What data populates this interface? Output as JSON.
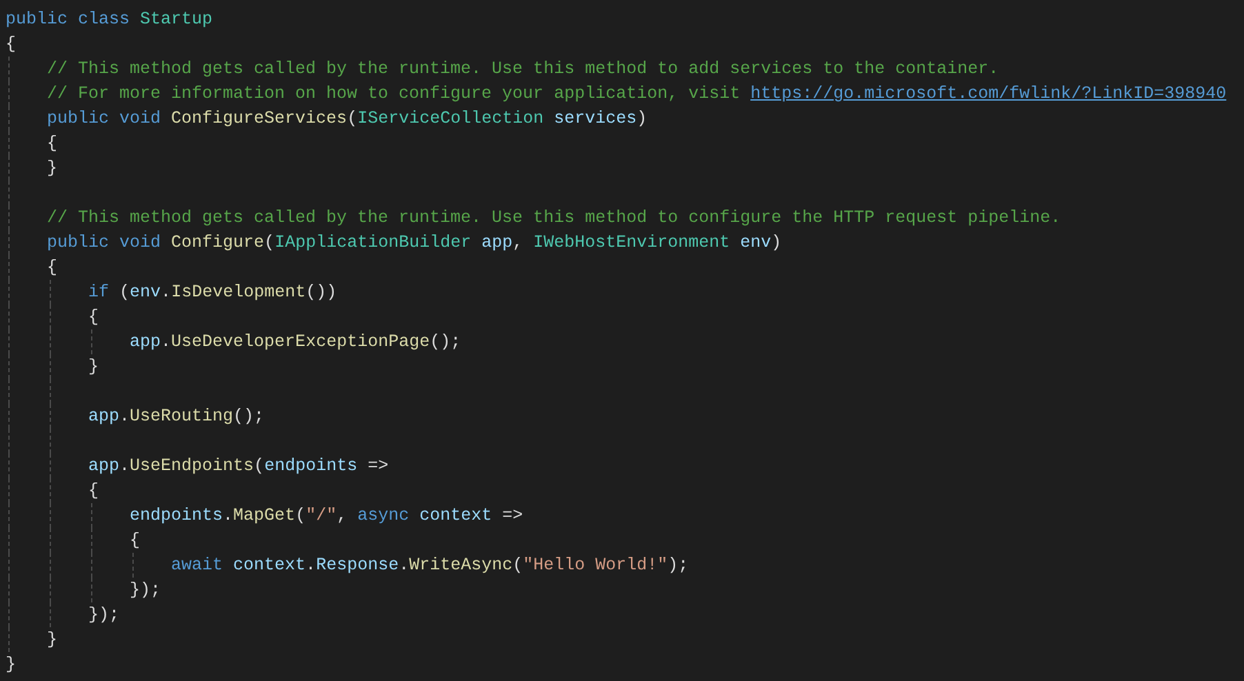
{
  "editor": {
    "lines": [
      {
        "tokens": [
          {
            "text": "public ",
            "kind": "keyword"
          },
          {
            "text": "class ",
            "kind": "keyword"
          },
          {
            "text": "Startup",
            "kind": "type"
          }
        ]
      },
      {
        "tokens": [
          {
            "text": "{",
            "kind": "plain"
          }
        ]
      },
      {
        "tokens": [
          {
            "text": "    // This method gets called by the runtime. Use this method to add services to the container.",
            "kind": "comment"
          }
        ]
      },
      {
        "tokens": [
          {
            "text": "    // For more information on how to configure your application, visit ",
            "kind": "comment"
          },
          {
            "text": "https://go.microsoft.com/fwlink/?LinkID=398940",
            "kind": "link"
          }
        ]
      },
      {
        "tokens": [
          {
            "text": "    public ",
            "kind": "keyword"
          },
          {
            "text": "void ",
            "kind": "keyword"
          },
          {
            "text": "ConfigureServices",
            "kind": "method"
          },
          {
            "text": "(",
            "kind": "plain"
          },
          {
            "text": "IServiceCollection ",
            "kind": "type"
          },
          {
            "text": "services",
            "kind": "variable"
          },
          {
            "text": ")",
            "kind": "plain"
          }
        ]
      },
      {
        "tokens": [
          {
            "text": "    {",
            "kind": "plain"
          }
        ]
      },
      {
        "tokens": [
          {
            "text": "    }",
            "kind": "plain"
          }
        ]
      },
      {
        "kind": "blank"
      },
      {
        "tokens": [
          {
            "text": "    // This method gets called by the runtime. Use this method to configure the HTTP request pipeline.",
            "kind": "comment"
          }
        ]
      },
      {
        "tokens": [
          {
            "text": "    public ",
            "kind": "keyword"
          },
          {
            "text": "void ",
            "kind": "keyword"
          },
          {
            "text": "Configure",
            "kind": "method"
          },
          {
            "text": "(",
            "kind": "plain"
          },
          {
            "text": "IApplicationBuilder ",
            "kind": "type"
          },
          {
            "text": "app",
            "kind": "variable"
          },
          {
            "text": ", ",
            "kind": "plain"
          },
          {
            "text": "IWebHostEnvironment ",
            "kind": "type"
          },
          {
            "text": "env",
            "kind": "variable"
          },
          {
            "text": ")",
            "kind": "plain"
          }
        ]
      },
      {
        "tokens": [
          {
            "text": "    {",
            "kind": "plain"
          }
        ]
      },
      {
        "tokens": [
          {
            "text": "        if",
            "kind": "keyword"
          },
          {
            "text": " (",
            "kind": "plain"
          },
          {
            "text": "env",
            "kind": "variable"
          },
          {
            "text": ".",
            "kind": "plain"
          },
          {
            "text": "IsDevelopment",
            "kind": "method"
          },
          {
            "text": "())",
            "kind": "plain"
          }
        ]
      },
      {
        "tokens": [
          {
            "text": "        {",
            "kind": "plain"
          }
        ]
      },
      {
        "tokens": [
          {
            "text": "            app",
            "kind": "variable"
          },
          {
            "text": ".",
            "kind": "plain"
          },
          {
            "text": "UseDeveloperExceptionPage",
            "kind": "method"
          },
          {
            "text": "();",
            "kind": "plain"
          }
        ]
      },
      {
        "tokens": [
          {
            "text": "        }",
            "kind": "plain"
          }
        ]
      },
      {
        "kind": "blank"
      },
      {
        "tokens": [
          {
            "text": "        app",
            "kind": "variable"
          },
          {
            "text": ".",
            "kind": "plain"
          },
          {
            "text": "UseRouting",
            "kind": "method"
          },
          {
            "text": "();",
            "kind": "plain"
          }
        ]
      },
      {
        "kind": "blank"
      },
      {
        "tokens": [
          {
            "text": "        app",
            "kind": "variable"
          },
          {
            "text": ".",
            "kind": "plain"
          },
          {
            "text": "UseEndpoints",
            "kind": "method"
          },
          {
            "text": "(",
            "kind": "plain"
          },
          {
            "text": "endpoints",
            "kind": "variable"
          },
          {
            "text": " =>",
            "kind": "plain"
          }
        ]
      },
      {
        "tokens": [
          {
            "text": "        {",
            "kind": "plain"
          }
        ]
      },
      {
        "tokens": [
          {
            "text": "            endpoints",
            "kind": "variable"
          },
          {
            "text": ".",
            "kind": "plain"
          },
          {
            "text": "MapGet",
            "kind": "method"
          },
          {
            "text": "(",
            "kind": "plain"
          },
          {
            "text": "\"/\"",
            "kind": "string"
          },
          {
            "text": ", ",
            "kind": "plain"
          },
          {
            "text": "async ",
            "kind": "keyword"
          },
          {
            "text": "context",
            "kind": "variable"
          },
          {
            "text": " =>",
            "kind": "plain"
          }
        ]
      },
      {
        "tokens": [
          {
            "text": "            {",
            "kind": "plain"
          }
        ]
      },
      {
        "tokens": [
          {
            "text": "                await ",
            "kind": "keyword"
          },
          {
            "text": "context",
            "kind": "variable"
          },
          {
            "text": ".",
            "kind": "plain"
          },
          {
            "text": "Response",
            "kind": "variable"
          },
          {
            "text": ".",
            "kind": "plain"
          },
          {
            "text": "WriteAsync",
            "kind": "method"
          },
          {
            "text": "(",
            "kind": "plain"
          },
          {
            "text": "\"Hello World!\"",
            "kind": "string"
          },
          {
            "text": ");",
            "kind": "plain"
          }
        ]
      },
      {
        "tokens": [
          {
            "text": "            });",
            "kind": "plain"
          }
        ]
      },
      {
        "tokens": [
          {
            "text": "        });",
            "kind": "plain"
          }
        ]
      },
      {
        "tokens": [
          {
            "text": "    }",
            "kind": "plain"
          }
        ]
      },
      {
        "tokens": [
          {
            "text": "}",
            "kind": "plain"
          }
        ]
      }
    ]
  }
}
